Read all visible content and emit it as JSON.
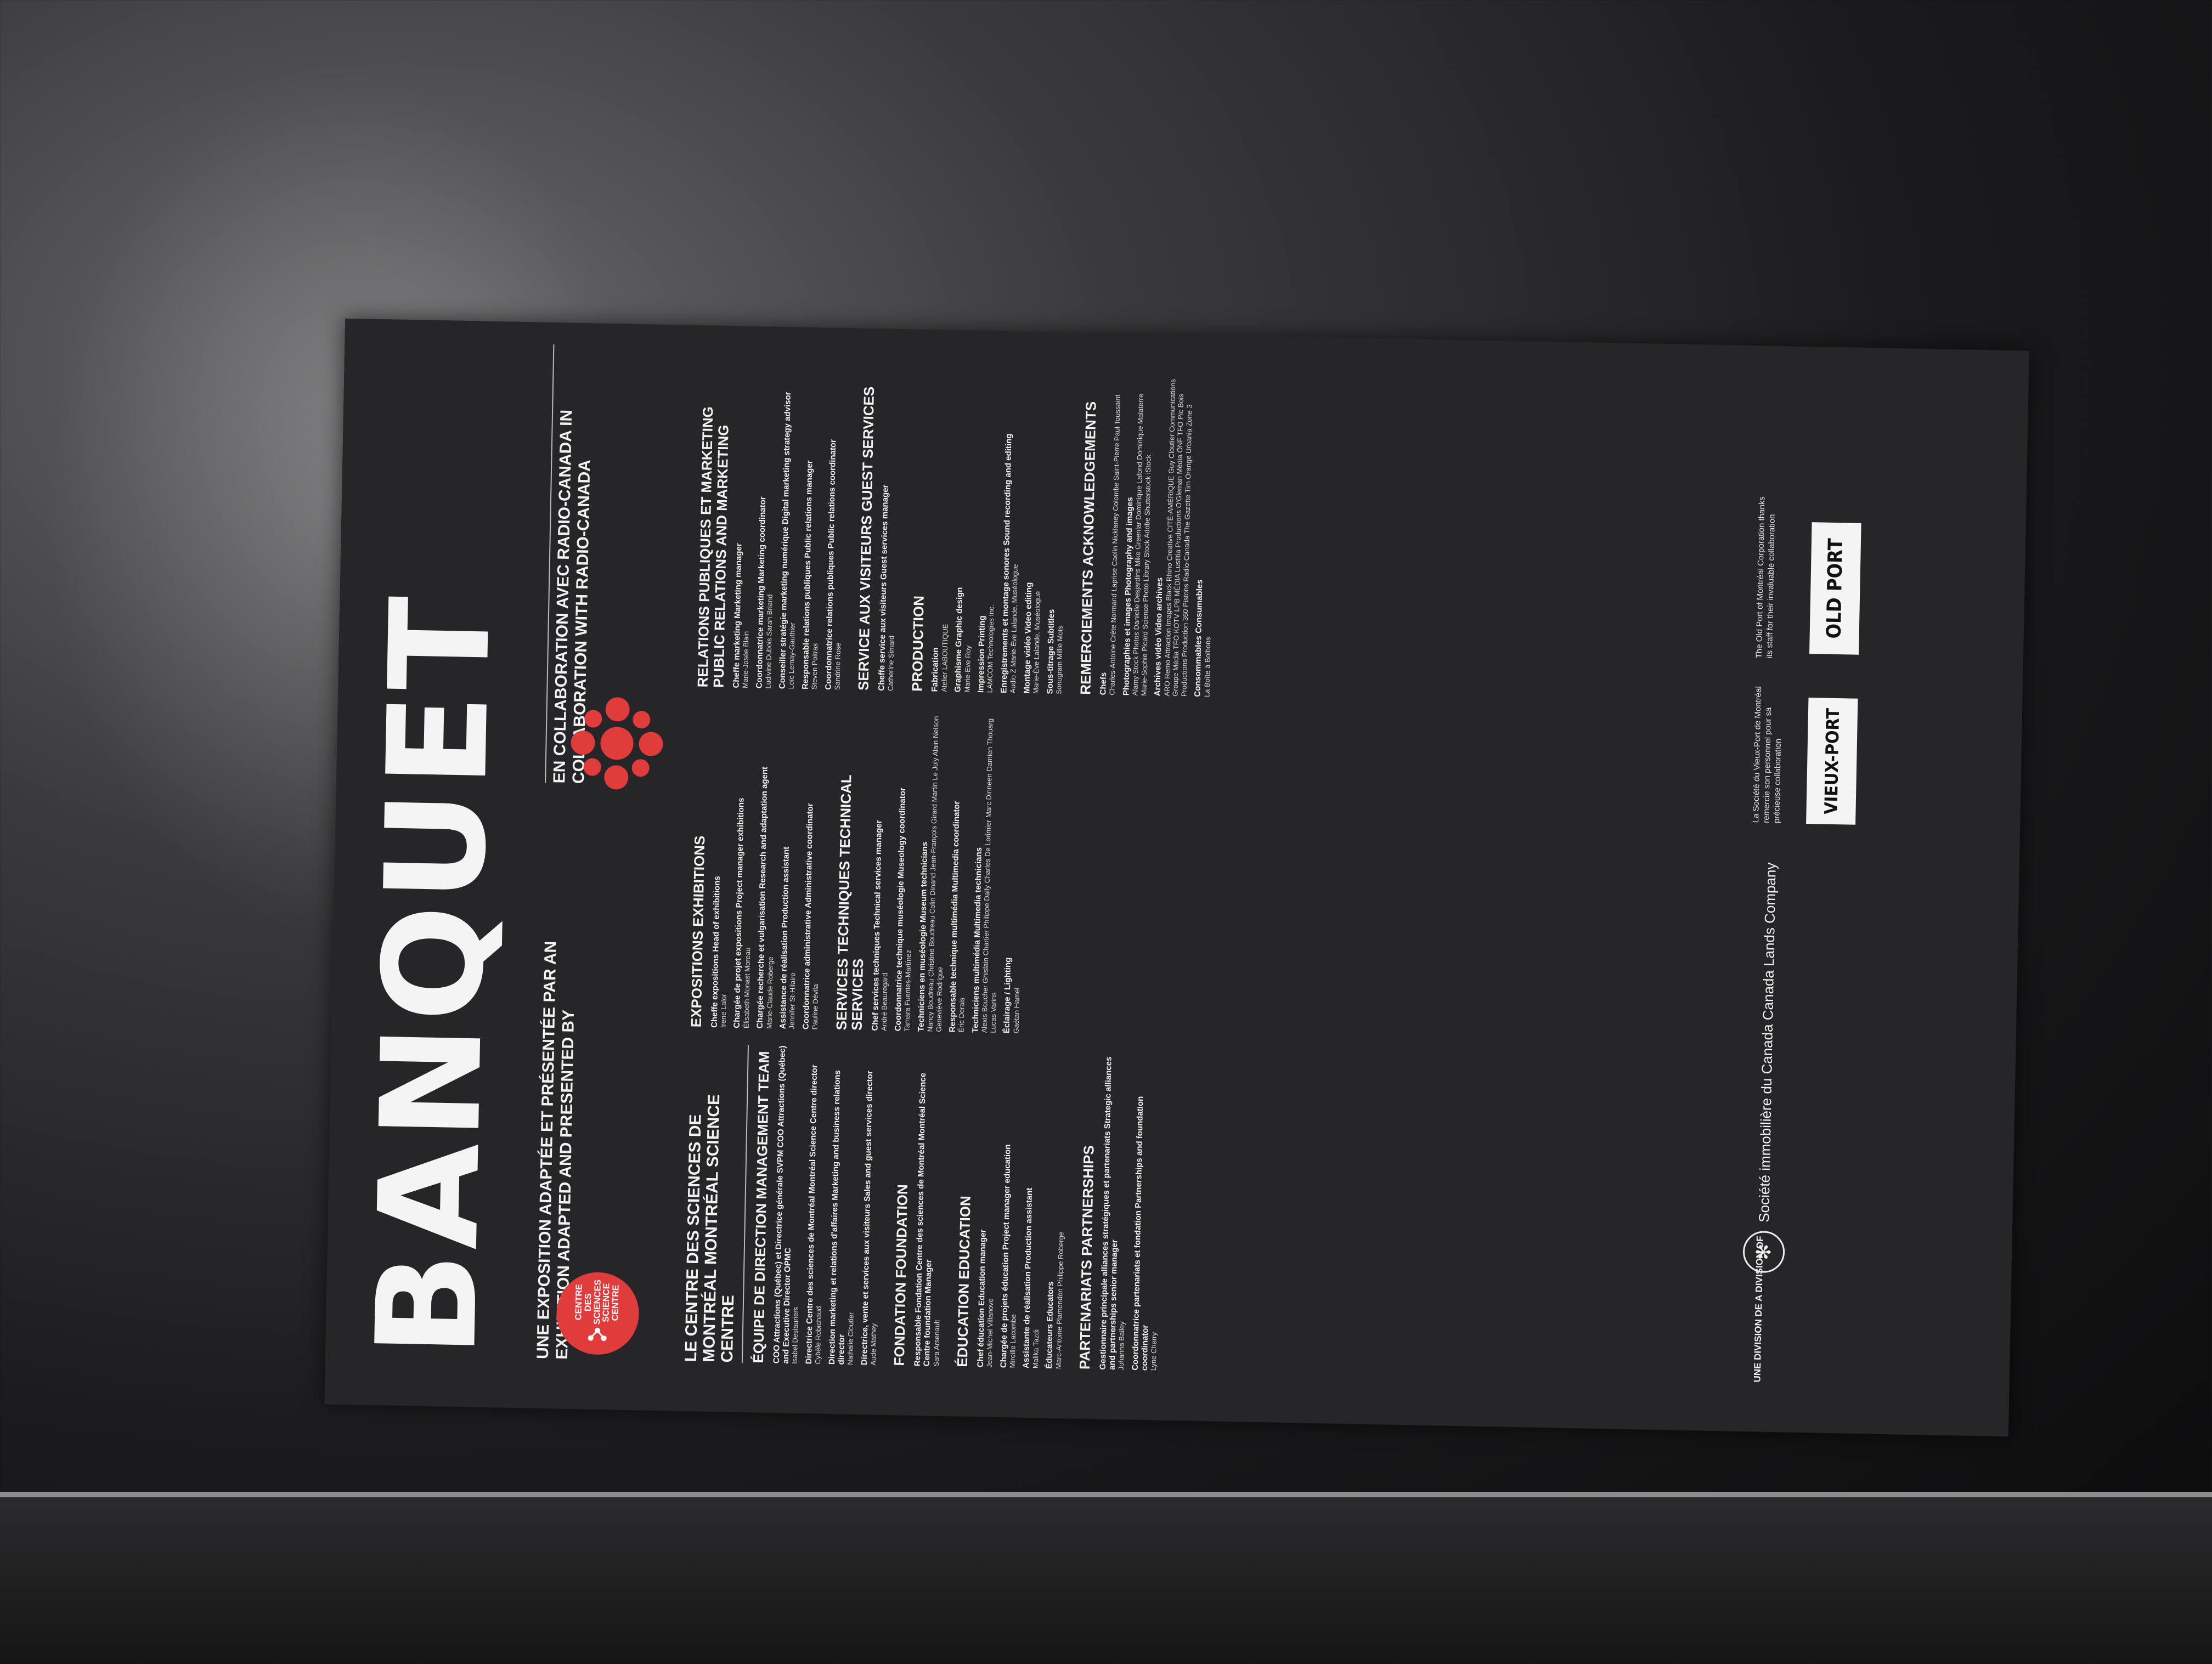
{
  "title": "BANQUET",
  "subtitle_fr_en": "UNE EXPOSITION ADAPTÉE ET PRÉSENTÉE PAR AN EXHIBITION ADAPTED AND PRESENTED BY",
  "collab": "EN COLLABORATION AVEC RADIO-CANADA IN COLLABORATION WITH RADIO-CANADA",
  "csc_logo_text": "CENTRE DES SCIENCES SCIENCE CENTRE",
  "col1": {
    "heading": "LE CENTRE DES SCIENCES DE MONTRÉAL MONTRÉAL SCIENCE CENTRE",
    "sections": [
      {
        "head": "ÉQUIPE DE DIRECTION MANAGEMENT TEAM",
        "entries": [
          {
            "role": "COO Attractions (Québec) et Directrice générale SVPM COO Attractions (Québec) and Executive Director OPMC",
            "person": "Isabel Deslauriers"
          },
          {
            "role": "Directrice Centre des sciences de Montréal Montréal Science Centre director",
            "person": "Cybèle Robichaud"
          },
          {
            "role": "Direction marketing et relations d'affaires Marketing and business relations director",
            "person": "Nathalie Cloutier"
          },
          {
            "role": "Directrice, vente et services aux visiteurs Sales and guest services director",
            "person": "Aude Mathey"
          }
        ]
      },
      {
        "head": "FONDATION FOUNDATION",
        "entries": [
          {
            "role": "Responsable Fondation Centre des sciences de Montréal Montréal Science Centre foundation Manager",
            "person": "Sara Arsenault"
          }
        ]
      },
      {
        "head": "ÉDUCATION EDUCATION",
        "entries": [
          {
            "role": "Chef éducation Education manager",
            "person": "Jean-Michel Villanove"
          },
          {
            "role": "Chargée de projets éducation Project manager education",
            "person": "Mireille Lacombe"
          },
          {
            "role": "Assistante de réalisation Production assistant",
            "person": "Malika Tazdi"
          },
          {
            "role": "Éducateurs Educators",
            "person": "Marc-Antoine Plamondon Philippe Roberge"
          }
        ]
      },
      {
        "head": "PARTENARIATS PARTNERSHIPS",
        "entries": [
          {
            "role": "Gestionnaire principale alliances stratégiques et partenariats Strategic alliances and partnerships senior manager",
            "person": "Johanna Bailey"
          },
          {
            "role": "Coordonnatrice partenariats et fondation Partnerships and foundation coordinator",
            "person": "Lyne Cherry"
          }
        ]
      }
    ]
  },
  "col2": {
    "sections": [
      {
        "head": "EXPOSITIONS EXHIBITIONS",
        "entries": [
          {
            "role": "Cheffe expositions Head of exhibitions",
            "person": "Irene Lalor"
          },
          {
            "role": "Chargée de projet expositions Project manager exhibitions",
            "person": "Élisabeth Monast Moreau"
          },
          {
            "role": "Chargée recherche et vulgarisation Research and adaptation agent",
            "person": "Marie-Claude Roberge"
          },
          {
            "role": "Assistance de réalisation Production assistant",
            "person": "Jennifer St-Hilaire"
          },
          {
            "role": "Coordonnatrice administrative Administrative coordinator",
            "person": "Pauline Dévila"
          }
        ]
      },
      {
        "head": "SERVICES TECHNIQUES TECHNICAL SERVICES",
        "entries": [
          {
            "role": "Chef services techniques Technical services manager",
            "person": "André Beauregard"
          },
          {
            "role": "Coordonnatrice technique muséologie Museology coordinator",
            "person": "Tamara Fuentes-Martínez"
          },
          {
            "role": "Techniciens en muséologie Museum technicians",
            "person": "Nancy Boudreau Christine Boudreau Colin Dinand Jean-François Girard Martin Le Joly Alain Nelson Geneviève Rodrigue"
          },
          {
            "role": "Responsable technique multimédia Multimedia coordinator",
            "person": "Éric Derais"
          },
          {
            "role": "Techniciens multimédia Multimedia technicians",
            "person": "Alexis Boucher Ghislain Chartier Philippe Dally Charles De Lorimier Marc Dinneen Damien Thouarg Lucas Varins"
          },
          {
            "role": "Éclairage / Lighting",
            "person": "Gaétan Hamel"
          }
        ]
      }
    ]
  },
  "col3": {
    "sections": [
      {
        "head": "RELATIONS PUBLIQUES ET MARKETING PUBLIC RELATIONS AND MARKETING",
        "entries": [
          {
            "role": "Cheffe marketing Marketing manager",
            "person": "Marie-Josée Blain"
          },
          {
            "role": "Coordonnatrice marketing Marketing coordinator",
            "person": "Ludivine Dubois Sarah Briand"
          },
          {
            "role": "Conseiller stratégie marketing numérique Digital marketing strategy advisor",
            "person": "Loïc Lemay-Gauthier"
          },
          {
            "role": "Responsable relations publiques Public relations manager",
            "person": "Steven Poitras"
          },
          {
            "role": "Coordonnatrice relations publiques Public relations coordinator",
            "person": "Sandrine Rose"
          }
        ]
      },
      {
        "head": "SERVICE AUX VISITEURS GUEST SERVICES",
        "entries": [
          {
            "role": "Cheffe service aux visiteurs Guest services manager",
            "person": "Catherine Simard"
          }
        ]
      },
      {
        "head": "PRODUCTION",
        "entries": [
          {
            "role": "Fabrication",
            "person": "Atelier LABOUTIQUE"
          },
          {
            "role": "Graphisme Graphic design",
            "person": "Marie-Eve Roy"
          },
          {
            "role": "Impression Printing",
            "person": "LAMCOM Technologies Inc."
          },
          {
            "role": "Enregistrements et montage sonores Sound recording and editing",
            "person": "Audio Z Marie-Ève Lalande, Muséologue"
          },
          {
            "role": "Montage vidéo Video editing",
            "person": "Marie-Ève Lalande, Muséologue"
          },
          {
            "role": "Sous-titrage Subtitles",
            "person": "Sonogram Millie Mots"
          }
        ]
      }
    ]
  },
  "col4": {
    "sections": [
      {
        "head": "REMERCIEMENTS ACKNOWLEDGEMENTS",
        "entries": [
          {
            "role": "Chefs",
            "person": "Charles-Antoine Crête Normand Laprise Caelin Nicklaney Colombe Saint-Pierre Paul Toussaint"
          },
          {
            "role": "Photographies et images Photography and images",
            "person": "Alamy Stock Photos Danielle Desjardins Mike Greenlar Dominique Lafond Dominique Malaterre Marie-Sophie Picard Science Photo Library Stock Adobe Shutterstock iStock"
          },
          {
            "role": "Archives vidéo Video archives",
            "person": "ARO Remo Attraction Images Black Rhino Creative CITÉ-AMÉRIQUE Guy Cloutier Communications Groupe Média TFO KOTV LPB MÉDIA Lustitia Productions O'Gleman Média ONF TFO Pic Bois Productions Production 360 Pistons Radio-Canada The Gazette Tim Orange Urbania Zone 3"
          },
          {
            "role": "Consommables Consumables",
            "person": "La Boîte à Bolbons"
          }
        ]
      }
    ]
  },
  "footer": {
    "division_label": "UNE DIVISION DE A DIVISION OF",
    "sic": "Société immobilière du Canada Canada Lands Company",
    "thanks_fr": "La Société du Vieux-Port de Montréal remercie son personnel pour sa précieuse collaboration",
    "thanks_en": "The Old Port of Montréal Corporation thanks its staff for their invaluable collaboration",
    "logo_vieux": "VIEUX-PORT",
    "logo_old": "OLD PORT"
  },
  "colors": {
    "board": "#262628",
    "accent_red": "#e03c3c",
    "text": "#f2f2f2"
  }
}
